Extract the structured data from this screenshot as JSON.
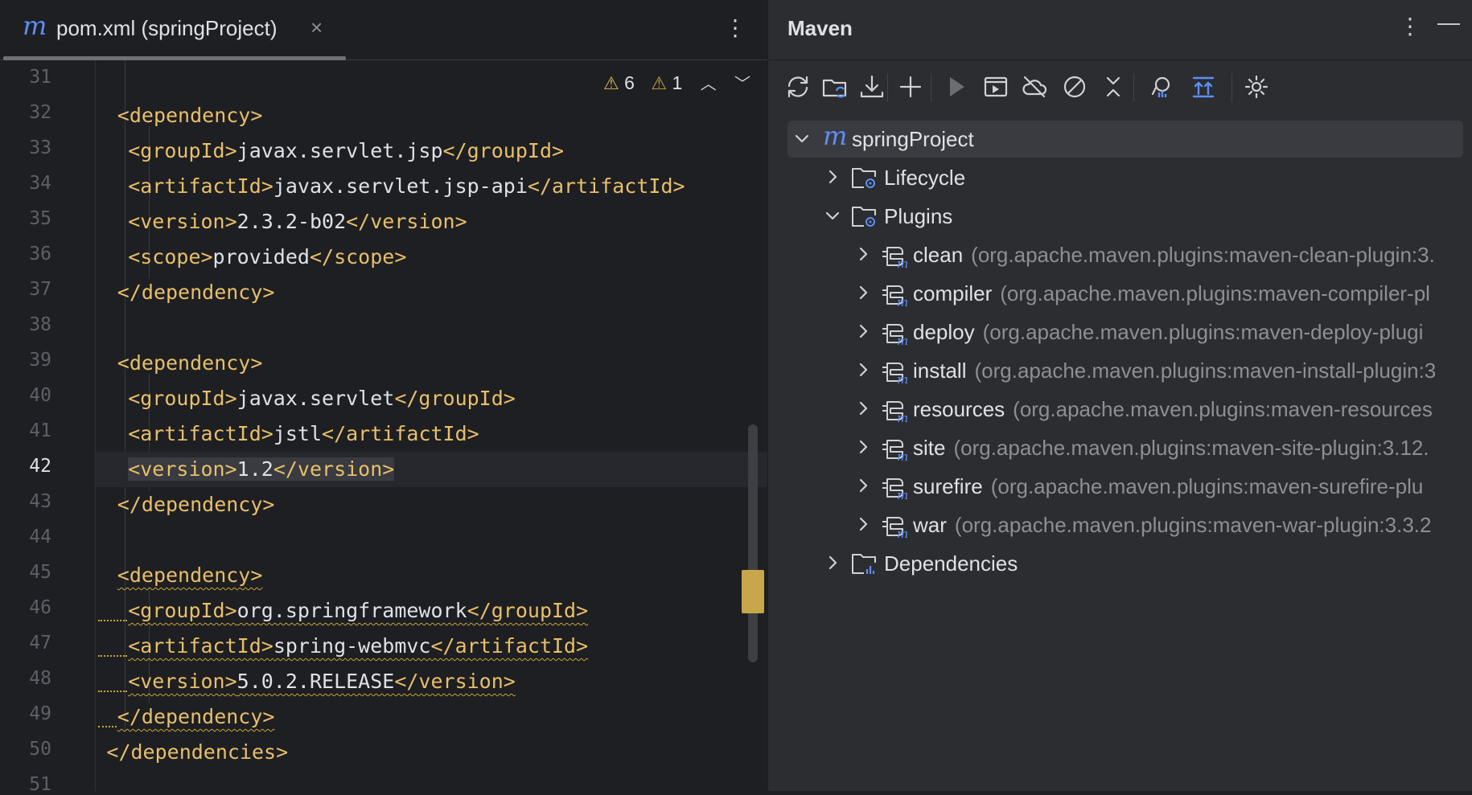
{
  "editor": {
    "tab": {
      "icon": "maven-m-icon",
      "title": "pom.xml (springProject)",
      "close": "×"
    },
    "menu_glyph": "⋮",
    "inspections": {
      "warnings": "6",
      "weak_warnings": "1"
    },
    "line_numbers": [
      "31",
      "32",
      "33",
      "34",
      "35",
      "36",
      "37",
      "38",
      "39",
      "40",
      "41",
      "42",
      "43",
      "44",
      "45",
      "46",
      "47",
      "48",
      "49",
      "50",
      "51"
    ],
    "current_line": "42",
    "lines": [
      {
        "indent": "",
        "parts": []
      },
      {
        "indent": "    ",
        "parts": [
          [
            "tag",
            "<dependency>"
          ]
        ]
      },
      {
        "indent": "      ",
        "parts": [
          [
            "tag",
            "<groupId>"
          ],
          [
            "txt",
            "javax.servlet.jsp"
          ],
          [
            "tag",
            "</groupId>"
          ]
        ]
      },
      {
        "indent": "      ",
        "parts": [
          [
            "tag",
            "<artifactId>"
          ],
          [
            "txt",
            "javax.servlet.jsp-api"
          ],
          [
            "tag",
            "</artifactId>"
          ]
        ]
      },
      {
        "indent": "      ",
        "parts": [
          [
            "tag",
            "<version>"
          ],
          [
            "txt",
            "2.3.2-b02"
          ],
          [
            "tag",
            "</version>"
          ]
        ]
      },
      {
        "indent": "      ",
        "parts": [
          [
            "tag",
            "<scope>"
          ],
          [
            "txt",
            "provided"
          ],
          [
            "tag",
            "</scope>"
          ]
        ]
      },
      {
        "indent": "    ",
        "parts": [
          [
            "tag",
            "</dependency>"
          ]
        ]
      },
      {
        "indent": "",
        "parts": []
      },
      {
        "indent": "    ",
        "parts": [
          [
            "tag",
            "<dependency>"
          ]
        ]
      },
      {
        "indent": "      ",
        "parts": [
          [
            "tag",
            "<groupId>"
          ],
          [
            "txt",
            "javax.servlet"
          ],
          [
            "tag",
            "</groupId>"
          ]
        ]
      },
      {
        "indent": "      ",
        "parts": [
          [
            "tag",
            "<artifactId>"
          ],
          [
            "txt",
            "jstl"
          ],
          [
            "tag",
            "</artifactId>"
          ]
        ]
      },
      {
        "indent": "      ",
        "parts": [
          [
            "tag",
            "<version>"
          ],
          [
            "txt",
            "1.2"
          ],
          [
            "tag",
            "</version>"
          ]
        ],
        "highlight": true
      },
      {
        "indent": "    ",
        "parts": [
          [
            "tag",
            "</dependency>"
          ]
        ]
      },
      {
        "indent": "",
        "parts": []
      },
      {
        "indent": "    ",
        "parts": [
          [
            "tag",
            "<dependency>"
          ]
        ],
        "wavy": true
      },
      {
        "indent": "      ",
        "parts": [
          [
            "tag",
            "<groupId>"
          ],
          [
            "txt",
            "org.springframework"
          ],
          [
            "tag",
            "</groupId>"
          ]
        ],
        "wavy": true,
        "lead": true
      },
      {
        "indent": "      ",
        "parts": [
          [
            "tag",
            "<artifactId>"
          ],
          [
            "txt",
            "spring-webmvc"
          ],
          [
            "tag",
            "</artifactId>"
          ]
        ],
        "wavy": true,
        "lead": true
      },
      {
        "indent": "      ",
        "parts": [
          [
            "tag",
            "<version>"
          ],
          [
            "txt",
            "5.0.2.RELEASE"
          ],
          [
            "tag",
            "</version>"
          ]
        ],
        "wavy": true,
        "lead": true
      },
      {
        "indent": "    ",
        "parts": [
          [
            "tag",
            "</dependency>"
          ]
        ],
        "wavy": true,
        "lead": true
      },
      {
        "indent": "  ",
        "parts": [
          [
            "tag",
            "</dependencies>"
          ]
        ]
      },
      {
        "indent": "",
        "parts": []
      }
    ]
  },
  "maven": {
    "title": "Maven",
    "menu_glyph": "⋮",
    "minimize_glyph": "—",
    "toolbar": [
      {
        "name": "reload-all-icon"
      },
      {
        "name": "generate-sources-icon"
      },
      {
        "name": "download-sources-icon"
      },
      {
        "name": "add-project-icon"
      },
      {
        "name": "run-icon"
      },
      {
        "name": "execute-goal-icon"
      },
      {
        "name": "offline-mode-icon"
      },
      {
        "name": "skip-tests-icon"
      },
      {
        "name": "collapse-all-icon"
      },
      {
        "name": "analyze-dependencies-icon"
      },
      {
        "name": "show-diagram-icon"
      },
      {
        "name": "settings-icon"
      }
    ],
    "tree": {
      "root": "springProject",
      "lifecycle": "Lifecycle",
      "plugins": "Plugins",
      "plugin_items": [
        {
          "name": "clean",
          "coord": "(org.apache.maven.plugins:maven-clean-plugin:3."
        },
        {
          "name": "compiler",
          "coord": "(org.apache.maven.plugins:maven-compiler-pl"
        },
        {
          "name": "deploy",
          "coord": "(org.apache.maven.plugins:maven-deploy-plugi"
        },
        {
          "name": "install",
          "coord": "(org.apache.maven.plugins:maven-install-plugin:3"
        },
        {
          "name": "resources",
          "coord": "(org.apache.maven.plugins:maven-resources"
        },
        {
          "name": "site",
          "coord": "(org.apache.maven.plugins:maven-site-plugin:3.12."
        },
        {
          "name": "surefire",
          "coord": "(org.apache.maven.plugins:maven-surefire-plu"
        },
        {
          "name": "war",
          "coord": "(org.apache.maven.plugins:maven-war-plugin:3.3.2"
        }
      ],
      "dependencies": "Dependencies"
    }
  },
  "colors": {
    "accent": "#5f8ef7",
    "tag": "#e8bf6a",
    "warning": "#e0b94a",
    "background": "#1e1f22",
    "panel": "#2b2d30"
  }
}
